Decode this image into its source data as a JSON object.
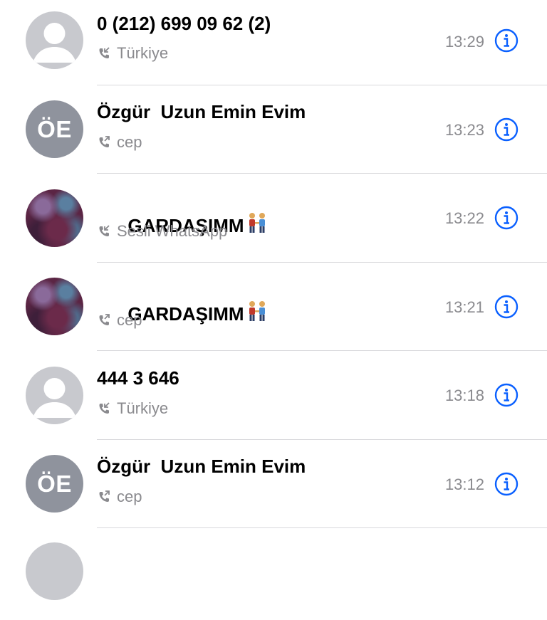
{
  "recents": [
    {
      "name": "0 (212) 699 09 62 (2)",
      "subtitle": "Türkiye",
      "time": "13:29",
      "avatar": "generic-person-icon",
      "emoji": ""
    },
    {
      "name": "Özgür  Uzun Emin Evim",
      "subtitle": "cep",
      "time": "13:23",
      "avatar": "initials",
      "initials": "ÖE",
      "emoji": ""
    },
    {
      "name": "GARDAŞIMM",
      "subtitle": "Sesli WhatsApp",
      "time": "13:22",
      "avatar": "photo",
      "emoji": "two-men-holding-hands-emoji"
    },
    {
      "name": "GARDAŞIMM",
      "subtitle": "cep",
      "time": "13:21",
      "avatar": "photo",
      "emoji": "two-men-holding-hands-emoji"
    },
    {
      "name": "444 3 646",
      "subtitle": "Türkiye",
      "time": "13:18",
      "avatar": "generic-person-icon",
      "emoji": ""
    },
    {
      "name": "Özgür  Uzun Emin Evim",
      "subtitle": "cep",
      "time": "13:12",
      "avatar": "initials",
      "initials": "ÖE",
      "emoji": ""
    }
  ],
  "colors": {
    "accent": "#0a60ff",
    "secondary_text": "#8a8a8e",
    "initials_avatar": "#8f939d",
    "generic_avatar": "#c8c9ce",
    "divider": "#d9d9dc"
  }
}
